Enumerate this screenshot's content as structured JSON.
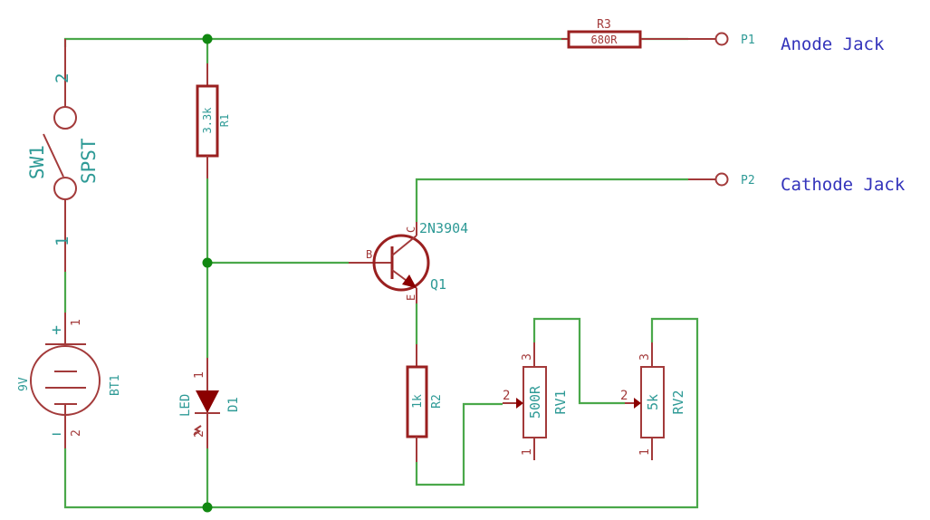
{
  "colors": {
    "wire": "#4aa84a",
    "component": "#9a2020",
    "reference_text": "#2e9a96",
    "port_label": "#3333bb",
    "junction": "#118811"
  },
  "ports": {
    "p1": {
      "ref": "P1",
      "label": "Anode Jack"
    },
    "p2": {
      "ref": "P2",
      "label": "Cathode Jack"
    }
  },
  "r3": {
    "ref": "R3",
    "value": "680R"
  },
  "r1": {
    "ref": "R1",
    "value": "3.3k"
  },
  "r2": {
    "ref": "R2",
    "value": "1k"
  },
  "sw1": {
    "ref": "SW1",
    "value": "SPST",
    "pin1": "1",
    "pin2": "2"
  },
  "bt1": {
    "ref": "BT1",
    "value": "9V",
    "pin1": "1",
    "pin2": "2",
    "plus": "+",
    "minus": "−"
  },
  "d1": {
    "ref": "D1",
    "value": "LED",
    "pin1": "1",
    "pin2": "2"
  },
  "q1": {
    "ref": "Q1",
    "value": "2N3904",
    "b": "B",
    "c": "C",
    "e": "E"
  },
  "rv1": {
    "ref": "RV1",
    "value": "500R",
    "pin1": "1",
    "pin2": "2",
    "pin3": "3"
  },
  "rv2": {
    "ref": "RV2",
    "value": "5k",
    "pin1": "1",
    "pin2": "2",
    "pin3": "3"
  }
}
